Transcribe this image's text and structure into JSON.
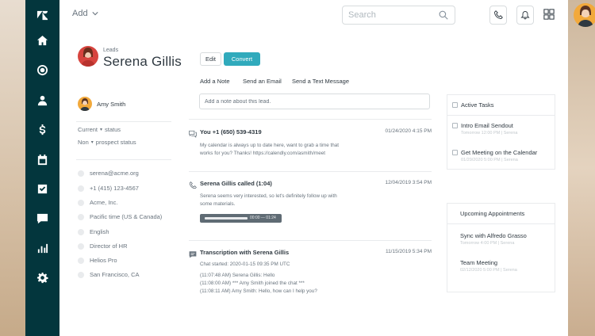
{
  "header": {
    "add_label": "Add",
    "search_placeholder": "Search"
  },
  "lead": {
    "label": "Leads",
    "name": "Serena Gillis",
    "owner": "Amy Smith",
    "status_label": "Current",
    "status_value": "status",
    "prospect_label": "Non",
    "prospect_value": "prospect status",
    "contacts": [
      "serena@acme.org",
      "+1 (415) 123-4567",
      "Acme, Inc.",
      "Pacific time (US & Canada)",
      "English",
      "Director of HR",
      "Helios Pro",
      "San Francisco, CA"
    ]
  },
  "actions": {
    "edit_label": "Edit",
    "convert_label": "Convert",
    "tabs": [
      "Add a Note",
      "Send an Email",
      "Send a Text Message"
    ],
    "note_placeholder": "Add a note about this lead."
  },
  "feed": [
    {
      "icon": "chat-icon",
      "title": "You  +1 (650) 539-4319",
      "date": "01/24/2020 4:15 PM",
      "body": [
        "My calendar is always up to date here, want to grab a time that",
        "works for you? Thanks! https://calendly.com/asmith/meet"
      ]
    },
    {
      "icon": "phone-icon",
      "title": "Serena Gillis called (1:04)",
      "date": "12/04/2019 3:54 PM",
      "body": [
        "Serena seems very interested, so let's definitely follow up with",
        "some materials."
      ],
      "audio_time": "00:00 — 01:24"
    },
    {
      "icon": "message-icon",
      "title": "Transcription with Serena Gillis",
      "date": "11/15/2019 5:34 PM",
      "body": [
        "Chat started: 2020-01-15 09:35 PM UTC",
        "",
        "(11:07:48 AM) Serena Gillis: Hello",
        "(11:08:00 AM) *** Amy Smith joined the chat ***",
        "(11:08:11 AM) Amy Smith: Hello, how can I help you?"
      ]
    }
  ],
  "tasks": {
    "title": "Active Tasks",
    "items": [
      {
        "label": "Intro Email Sendout",
        "sub": "Tomorrow 12:00 PM  |  Serena"
      },
      {
        "label": "Get Meeting on the Calendar",
        "sub": "01/29/2020 5:00 PM  |  Serena"
      }
    ]
  },
  "appointments": {
    "title": "Upcoming Appointments",
    "items": [
      {
        "label": "Sync with Alfredo Grasso",
        "sub": "Tomorrow 4:00 PM  |  Serena"
      },
      {
        "label": "Team Meeting",
        "sub": "02/12/2020 5:00 PM  |  Serena"
      }
    ]
  },
  "colors": {
    "sidebar": "#03363d",
    "accent": "#30aabc"
  }
}
